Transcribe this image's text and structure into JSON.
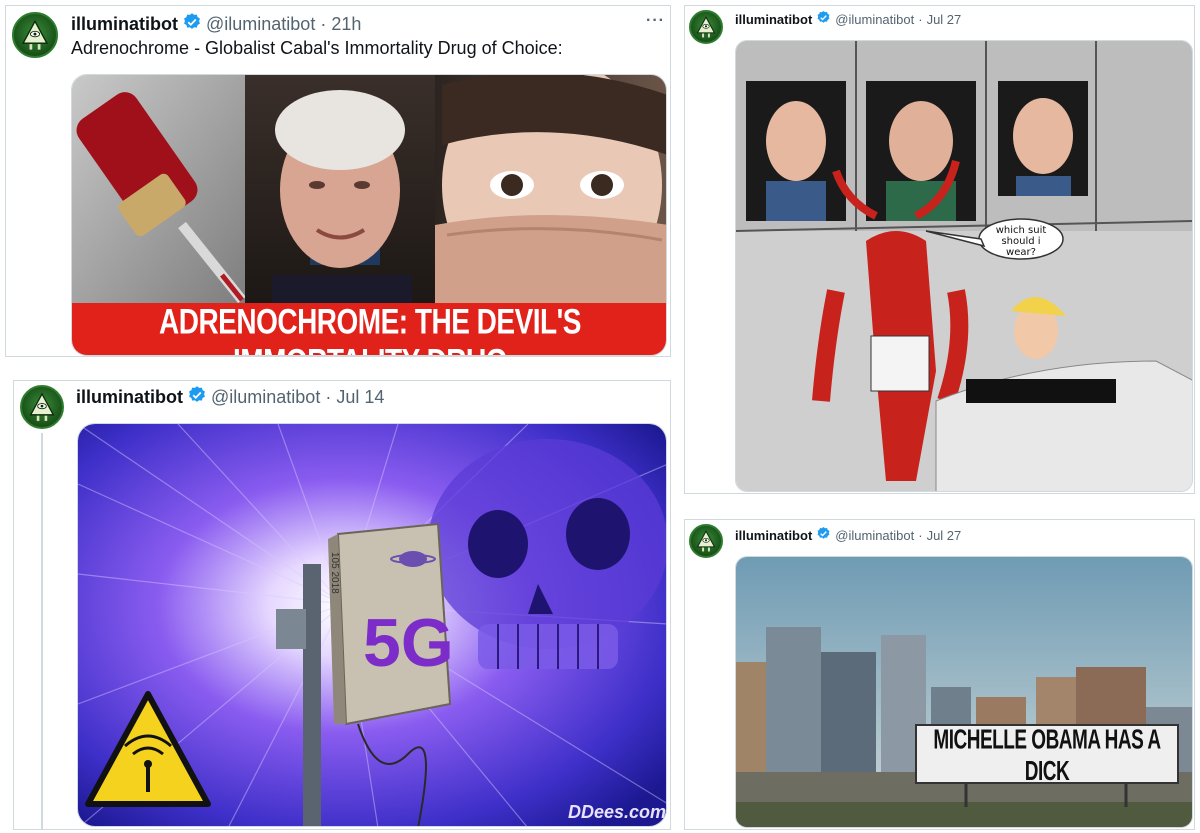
{
  "posts": [
    {
      "name": "illuminatibot",
      "handle": "@iluminatibot",
      "time": "21h",
      "text": "Adrenochrome - Globalist Cabal's Immortality Drug of Choice:",
      "banner": "ADRENOCHROME:  THE DEVIL'S IMMORTALITY DRUG",
      "more": "···"
    },
    {
      "name": "illuminatibot",
      "handle": "@iluminatibot",
      "time": "Jul 14",
      "image_text": "5G",
      "small_text": "105 2018",
      "credit": "DDees.com"
    },
    {
      "name": "illuminatibot",
      "handle": "@iluminatibot",
      "time": "Jul 27",
      "speech": "which suit should i wear?"
    },
    {
      "name": "illuminatibot",
      "handle": "@iluminatibot",
      "time": "Jul 27",
      "billboard": "MICHELLE OBAMA HAS A DICK"
    }
  ],
  "separator": "·",
  "colors": {
    "verified": "#1d9bf0",
    "banner_red": "#e0221b",
    "handle_gray": "#536471"
  }
}
